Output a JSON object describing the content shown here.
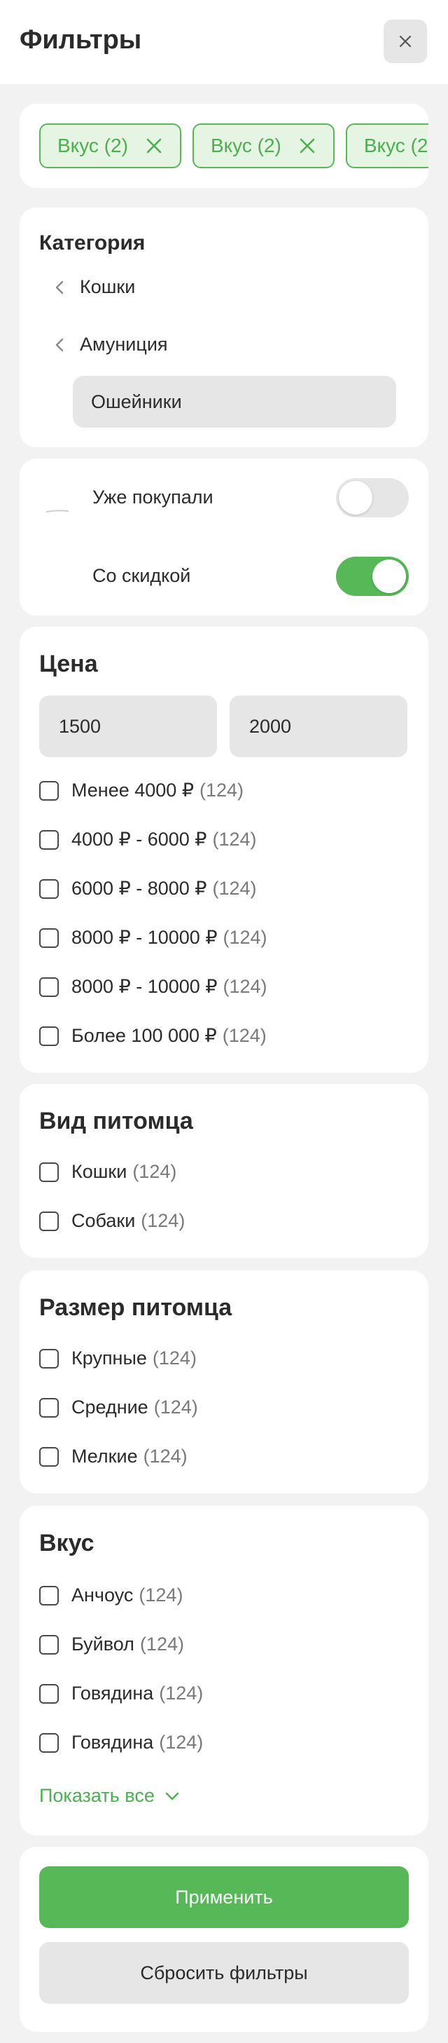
{
  "header": {
    "title": "Фильтры",
    "close_icon": "close-icon"
  },
  "selected_tags": [
    {
      "label": "Вкус (2)"
    },
    {
      "label": "Вкус (2)"
    },
    {
      "label": "Вкус (2)"
    }
  ],
  "category": {
    "title": "Категория",
    "levels": [
      "Кошки",
      "Амуниция"
    ],
    "selected": "Ошейники"
  },
  "toggles": [
    {
      "label": "Уже покупали",
      "on": false
    },
    {
      "label": "Со скидкой",
      "on": true
    }
  ],
  "price": {
    "title": "Цена",
    "min_value": "1500",
    "max_value": "2000",
    "options": [
      {
        "label": "Менее 4000 ₽",
        "count": "(124)"
      },
      {
        "label": "4000 ₽ - 6000 ₽",
        "count": "(124)"
      },
      {
        "label": "6000 ₽ - 8000 ₽",
        "count": "(124)"
      },
      {
        "label": "8000 ₽ - 10000 ₽",
        "count": "(124)"
      },
      {
        "label": "8000 ₽ - 10000 ₽",
        "count": "(124)"
      },
      {
        "label": "Более 100 000 ₽",
        "count": "(124)"
      }
    ]
  },
  "pet_type": {
    "title": "Вид питомца",
    "options": [
      {
        "label": "Кошки",
        "count": "(124)"
      },
      {
        "label": "Собаки",
        "count": "(124)"
      }
    ]
  },
  "pet_size": {
    "title": "Размер питомца",
    "options": [
      {
        "label": "Крупные",
        "count": "(124)"
      },
      {
        "label": "Средние",
        "count": "(124)"
      },
      {
        "label": "Мелкие",
        "count": "(124)"
      }
    ]
  },
  "taste": {
    "title": "Вкус",
    "options": [
      {
        "label": "Анчоус",
        "count": "(124)"
      },
      {
        "label": "Буйвол",
        "count": "(124)"
      },
      {
        "label": "Говядина",
        "count": "(124)"
      },
      {
        "label": "Говядина",
        "count": "(124)"
      }
    ],
    "show_all": "Показать все"
  },
  "actions": {
    "apply": "Применить",
    "reset": "Сбросить фильтры"
  },
  "colors": {
    "accent": "#57b857",
    "accent_light": "#e6f4e3",
    "background": "#f2f2f2",
    "input_bg": "#e6e6e6"
  }
}
